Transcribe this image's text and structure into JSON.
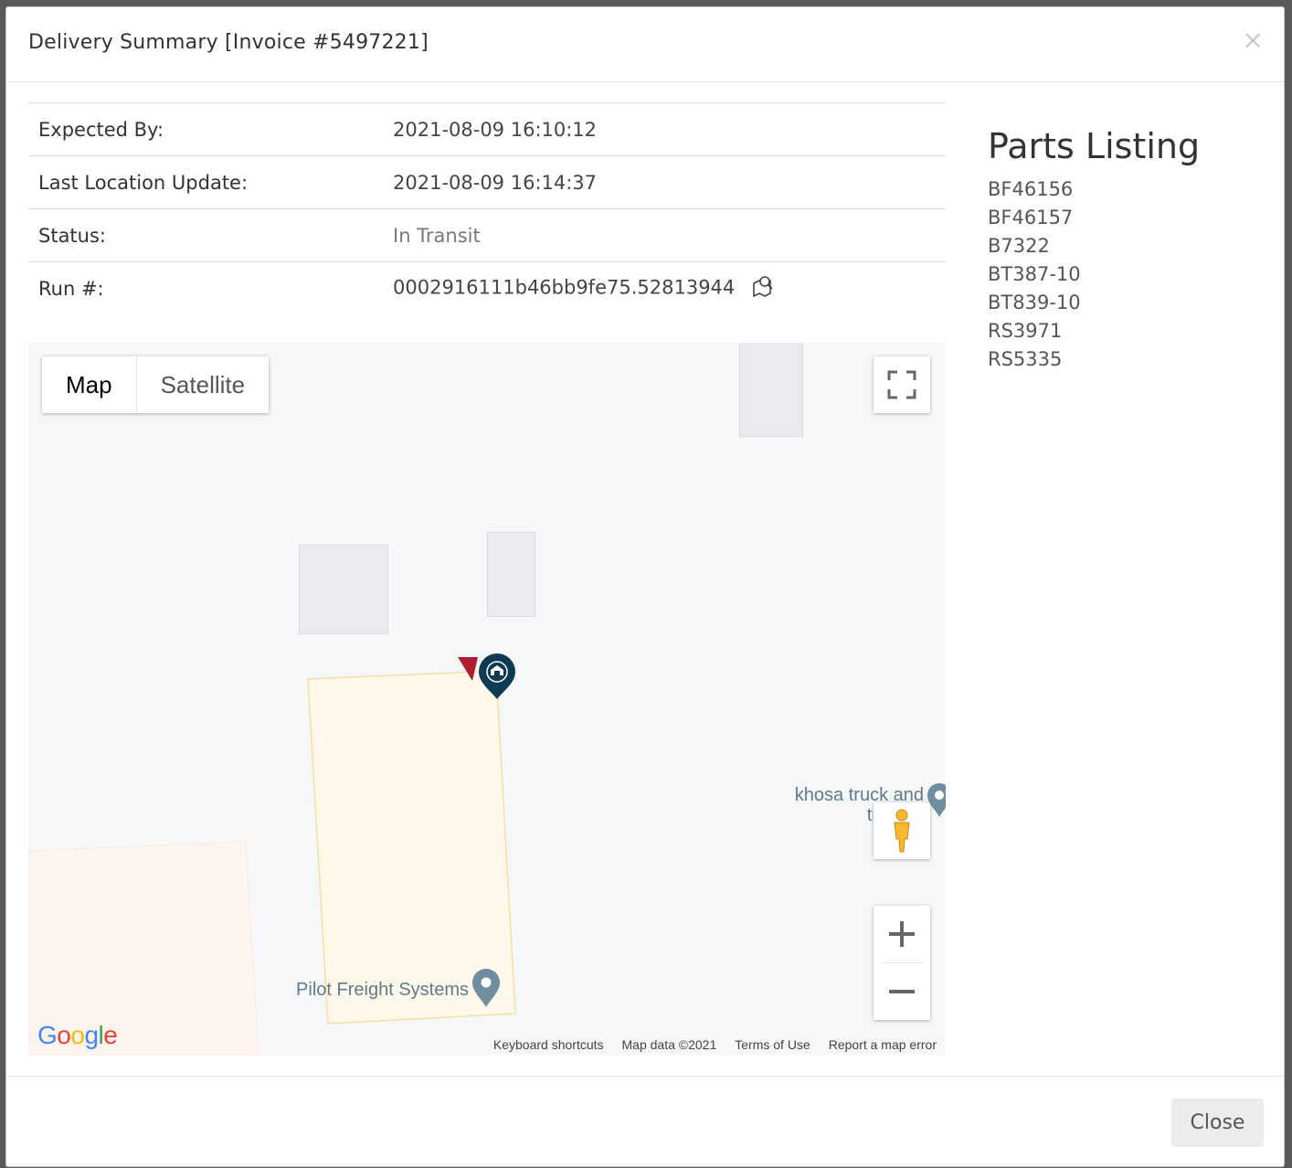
{
  "modal": {
    "title": "Delivery Summary [Invoice #5497221]",
    "close_symbol": "×"
  },
  "details": {
    "rows": [
      {
        "label": "Expected By:",
        "value": "2021-08-09 16:10:12"
      },
      {
        "label": "Last Location Update:",
        "value": "2021-08-09 16:14:37"
      },
      {
        "label": "Status:",
        "value": "In Transit"
      },
      {
        "label": "Run #:",
        "value": "0002916111b46bb9fe75.52813944"
      }
    ],
    "run_icon": "map-search-icon"
  },
  "parts": {
    "heading": "Parts Listing",
    "items": [
      "BF46156",
      "BF46157",
      "B7322",
      "BT387-10",
      "BT839-10",
      "RS3971",
      "RS5335"
    ]
  },
  "map": {
    "type_buttons": {
      "map": "Map",
      "satellite": "Satellite"
    },
    "poi": {
      "khosa": "khosa truck and trailer r",
      "pilot": "Pilot Freight Systems"
    },
    "attribution": {
      "shortcuts": "Keyboard shortcuts",
      "data": "Map data ©2021",
      "terms": "Terms of Use",
      "report": "Report a map error"
    },
    "logo": [
      "G",
      "o",
      "o",
      "g",
      "l",
      "e"
    ],
    "logo_colors": [
      "#4285F4",
      "#EA4335",
      "#FBBC05",
      "#4285F4",
      "#34A853",
      "#EA4335"
    ],
    "icons": {
      "fullscreen": "fullscreen-icon",
      "pegman": "pegman-icon",
      "zoom_in": "zoom-in-icon",
      "zoom_out": "zoom-out-icon",
      "delivery_marker": "warehouse-marker-icon",
      "truck_marker": "truck-direction-icon"
    }
  },
  "footer": {
    "close_label": "Close"
  }
}
